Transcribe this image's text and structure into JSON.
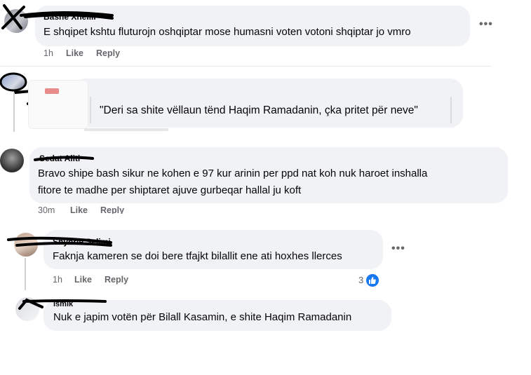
{
  "comments": [
    {
      "author": "Bashe Xhelili",
      "text": "E shqipet kshtu fluturojn oshqiptar mose humasni voten votoni shqiptar jo vmro",
      "time": "1h",
      "like_label": "Like",
      "reply_label": "Reply",
      "more_icon": "more-horizontal-icon"
    },
    {
      "author": "",
      "text": "\"Deri sa shite vëllaun tënd Haqim Ramadanin, çka pritet për neve\"",
      "time": "",
      "like_label": "",
      "reply_label": ""
    },
    {
      "author": "Sedat Aliti",
      "text_line1": "Bravo shipe bash sikur ne kohen e 97 kur arinin per ppd nat koh nuk haroet inshalla",
      "text_line2": "fitore te madhe per shiptaret ajuve gurbeqar hallal ju koft",
      "time": "30m",
      "like_label": "Like",
      "reply_label": "Reply"
    },
    {
      "author": "Shyhrie Selimi",
      "text": "Faknja kameren se doi bere tfajkt bilallit ene ati hoxhes llerces",
      "time": "1h",
      "like_label": "Like",
      "reply_label": "Reply",
      "reaction_count": "3",
      "more_icon": "more-horizontal-icon"
    },
    {
      "author": "Ismik",
      "text": "Nuk e japim votën për Bilall Kasamin, e shite Haqim Ramadanin"
    }
  ],
  "colors": {
    "bubble": "#f0f2f5",
    "meta": "#65676b",
    "like_blue": "#1877f2",
    "thread_line": "#ced0d4"
  }
}
